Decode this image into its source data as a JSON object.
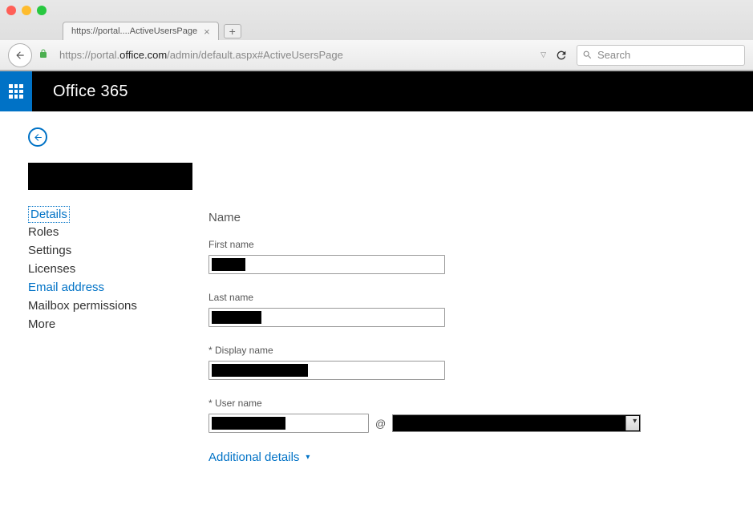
{
  "browser": {
    "tab_title": "https://portal....ActiveUsersPage",
    "url_prefix": "https://portal.",
    "url_bold": "office.com",
    "url_suffix": "/admin/default.aspx#ActiveUsersPage",
    "search_placeholder": "Search"
  },
  "header": {
    "title": "Office 365"
  },
  "sidebar": {
    "items": [
      {
        "label": "Details",
        "state": "active"
      },
      {
        "label": "Roles",
        "state": "normal"
      },
      {
        "label": "Settings",
        "state": "normal"
      },
      {
        "label": "Licenses",
        "state": "normal"
      },
      {
        "label": "Email address",
        "state": "link"
      },
      {
        "label": "Mailbox permissions",
        "state": "normal"
      },
      {
        "label": "More",
        "state": "normal"
      }
    ]
  },
  "form": {
    "section": "Name",
    "first_name_label": "First name",
    "last_name_label": "Last name",
    "display_name_label": "* Display name",
    "user_name_label": "* User name",
    "at": "@",
    "expand_label": "Additional details"
  }
}
